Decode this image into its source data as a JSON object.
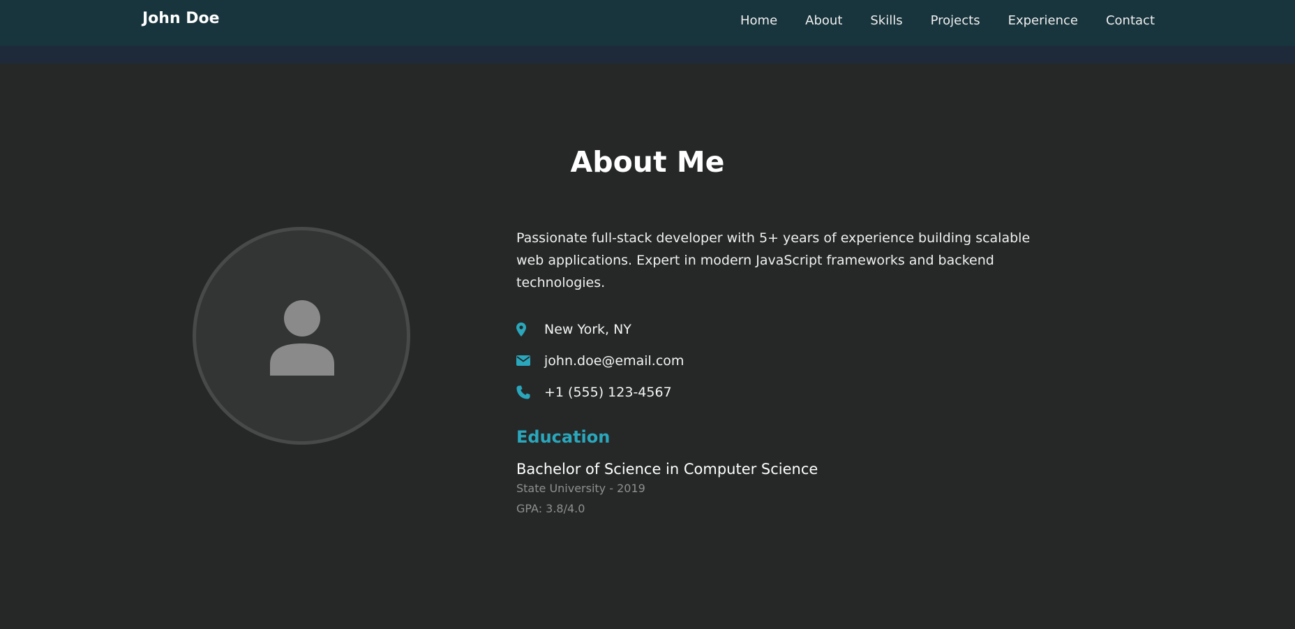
{
  "nav": {
    "brand": "John Doe",
    "links": [
      "Home",
      "About",
      "Skills",
      "Projects",
      "Experience",
      "Contact"
    ]
  },
  "about": {
    "title": "About Me",
    "bio": "Passionate full-stack developer with 5+ years of experience building scalable web applications. Expert in modern JavaScript frameworks and backend technologies.",
    "contacts": [
      {
        "icon": "map-marker-icon",
        "text": "New York, NY"
      },
      {
        "icon": "envelope-icon",
        "text": "john.doe@email.com"
      },
      {
        "icon": "phone-icon",
        "text": "+1 (555) 123-4567"
      }
    ],
    "education": {
      "heading": "Education",
      "degree": "Bachelor of Science in Computer Science",
      "school": "State University - 2019",
      "gpa": "GPA: 3.8/4.0"
    }
  },
  "colors": {
    "accent": "#2aa7bc",
    "background": "#262828",
    "navbar": "#18343c"
  }
}
